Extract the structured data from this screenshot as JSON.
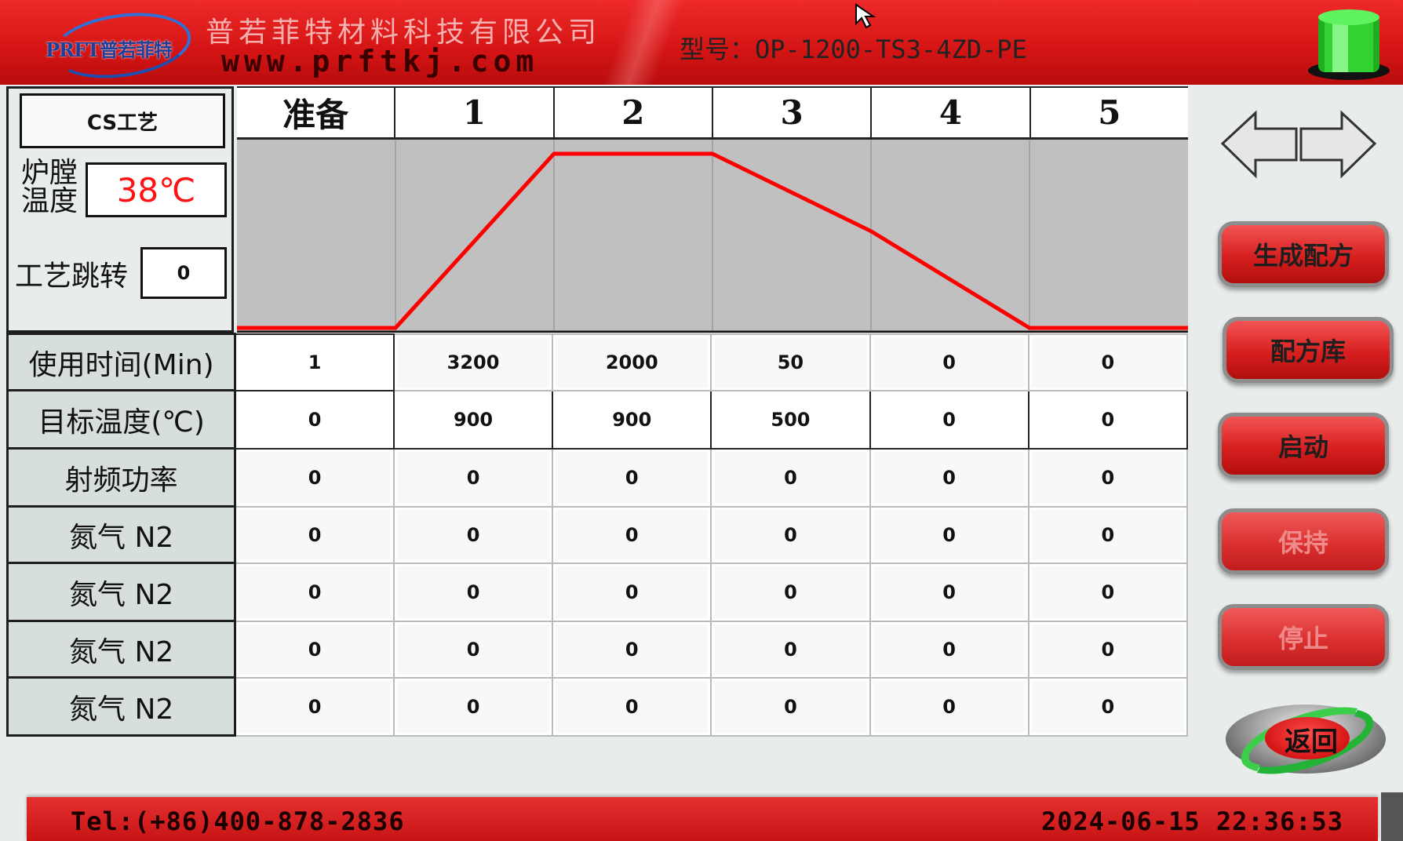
{
  "header": {
    "logo_text": "PRFT普若菲特",
    "company_name": "普若菲特材料科技有限公司",
    "website": "www.prftkj.com",
    "model_label": "型号：OP-1200-TS3-4ZD-PE",
    "status_light_color": "#22dd22",
    "brand_color": "#d41414"
  },
  "left_panel": {
    "process_name": "CS工艺",
    "chamber_temp_label": "炉膛温度",
    "chamber_temp_value": "38℃",
    "jump_label": "工艺跳转",
    "jump_value": "0"
  },
  "steps": [
    "准备",
    "1",
    "2",
    "3",
    "4",
    "5"
  ],
  "chart_data": {
    "type": "line",
    "categories": [
      "准备",
      "1",
      "2",
      "3",
      "4",
      "5"
    ],
    "series": [
      {
        "values": [
          0,
          900,
          900,
          500,
          0,
          0
        ],
        "color": "#ff0000"
      }
    ],
    "ylim": [
      0,
      900
    ],
    "grid": true
  },
  "table": {
    "rows": [
      {
        "label": "使用时间(Min)",
        "values": [
          "1",
          "3200",
          "2000",
          "50",
          "0",
          "0"
        ]
      },
      {
        "label": "目标温度(℃)",
        "values": [
          "0",
          "900",
          "900",
          "500",
          "0",
          "0"
        ]
      },
      {
        "label": "射频功率",
        "values": [
          "0",
          "0",
          "0",
          "0",
          "0",
          "0"
        ]
      },
      {
        "label": "氮气 N2",
        "values": [
          "0",
          "0",
          "0",
          "0",
          "0",
          "0"
        ]
      },
      {
        "label": "氮气 N2",
        "values": [
          "0",
          "0",
          "0",
          "0",
          "0",
          "0"
        ]
      },
      {
        "label": "氮气 N2",
        "values": [
          "0",
          "0",
          "0",
          "0",
          "0",
          "0"
        ]
      },
      {
        "label": "氮气 N2",
        "values": [
          "0",
          "0",
          "0",
          "0",
          "0",
          "0"
        ]
      }
    ]
  },
  "buttons": {
    "generate": "生成配方",
    "library": "配方库",
    "start": "启动",
    "hold": "保持",
    "stop": "停止",
    "back": "返回"
  },
  "footer": {
    "phone": "Tel:(+86)400-878-2836",
    "datetime": "2024-06-15 22:36:53"
  }
}
